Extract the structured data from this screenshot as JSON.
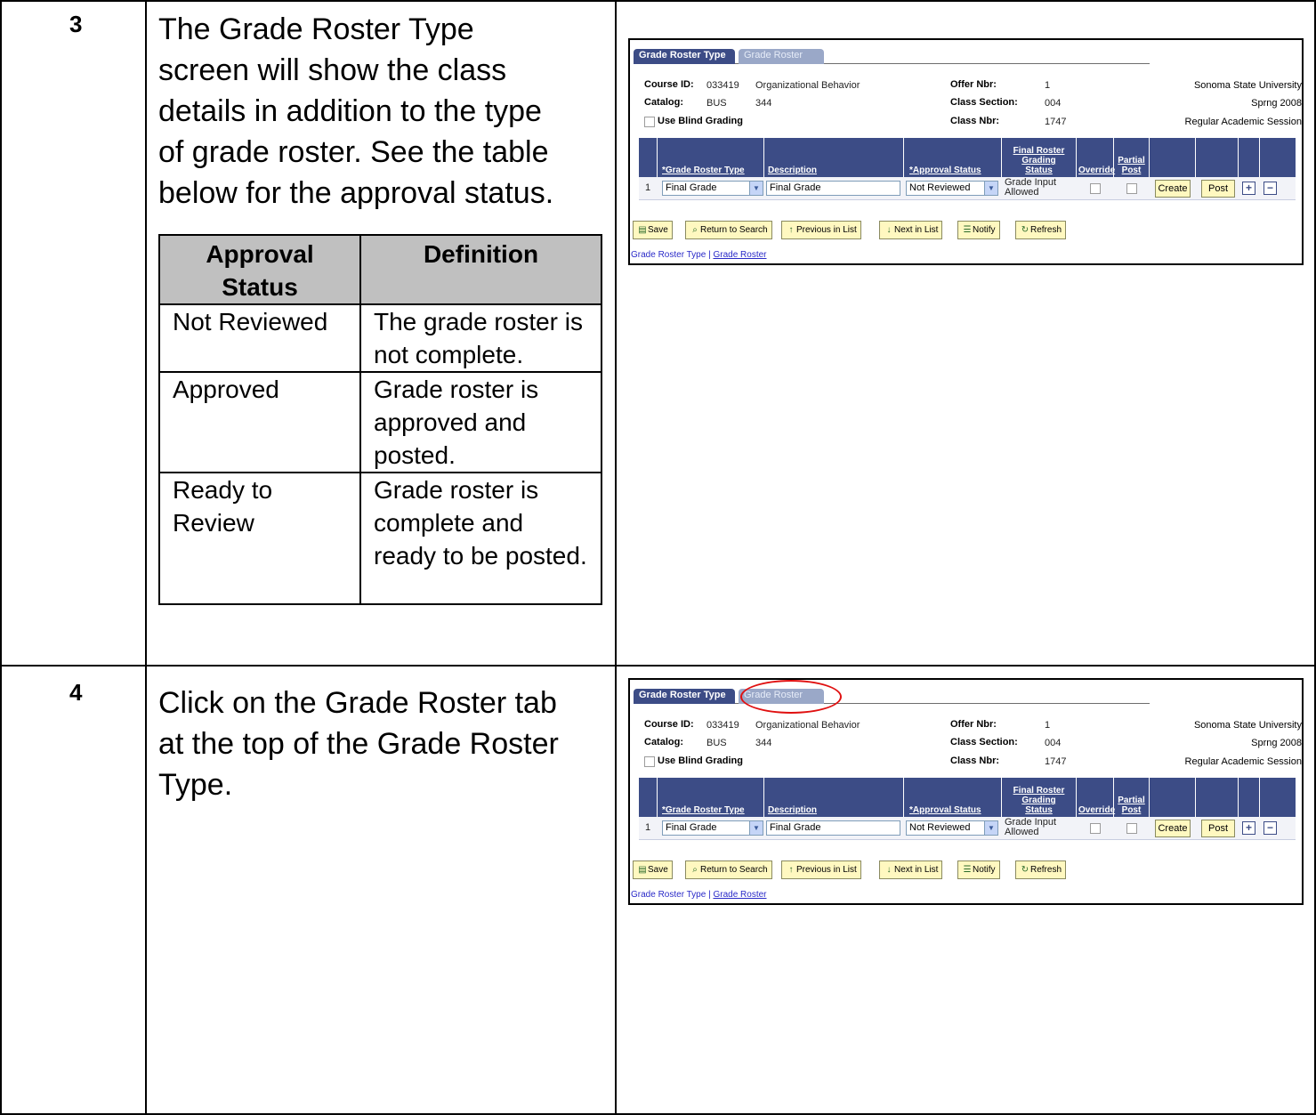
{
  "steps": [
    {
      "number": "3",
      "text_lines": [
        "The Grade Roster Type",
        "screen will show the class",
        "details in addition to the type",
        "of grade roster.  See the table",
        "below for the approval status."
      ]
    },
    {
      "number": "4",
      "text_lines": [
        "Click on the Grade Roster tab",
        "at the top of the Grade Roster",
        "Type."
      ]
    }
  ],
  "approval_table": {
    "headers": [
      "Approval Status",
      "Definition"
    ],
    "rows": [
      [
        "Not Reviewed",
        "The grade roster is not complete."
      ],
      [
        "Approved",
        "Grade roster is approved and posted."
      ],
      [
        "Ready to Review",
        "Grade roster is complete and ready to be posted."
      ]
    ]
  },
  "ps": {
    "tabs": [
      "Grade Roster Type",
      "Grade Roster"
    ],
    "course_id_label": "Course ID:",
    "course_id": "033419",
    "course_title": "Organizational Behavior",
    "offer_nbr_label": "Offer Nbr:",
    "offer_nbr": "1",
    "institution": "Sonoma State University",
    "catalog_label": "Catalog:",
    "catalog_subject": "BUS",
    "catalog_nbr": "344",
    "class_section_label": "Class Section:",
    "class_section": "004",
    "term": "Sprng 2008",
    "blind_label": "Use Blind Grading",
    "class_nbr_label": "Class Nbr:",
    "class_nbr": "1747",
    "session": "Regular Academic Session",
    "grid_headers": {
      "type": "*Grade Roster Type",
      "description": "Description",
      "approval": "*Approval Status",
      "final_1": "Final Roster",
      "final_2": "Grading",
      "final_3": "Status",
      "override": "Override",
      "partial_1": "Partial",
      "partial_2": "Post"
    },
    "row": {
      "num": "1",
      "type": "Final Grade",
      "description": "Final Grade",
      "approval": "Not Reviewed",
      "grading_1": "Grade Input",
      "grading_2": "Allowed",
      "create": "Create",
      "post": "Post",
      "plus": "+",
      "minus": "−"
    },
    "toolbar": [
      "Save",
      "Return to Search",
      "Previous in List",
      "Next in List",
      "Notify",
      "Refresh"
    ],
    "link_type": "Grade Roster Type",
    "link_sep": " | ",
    "link_roster": "Grade Roster"
  }
}
